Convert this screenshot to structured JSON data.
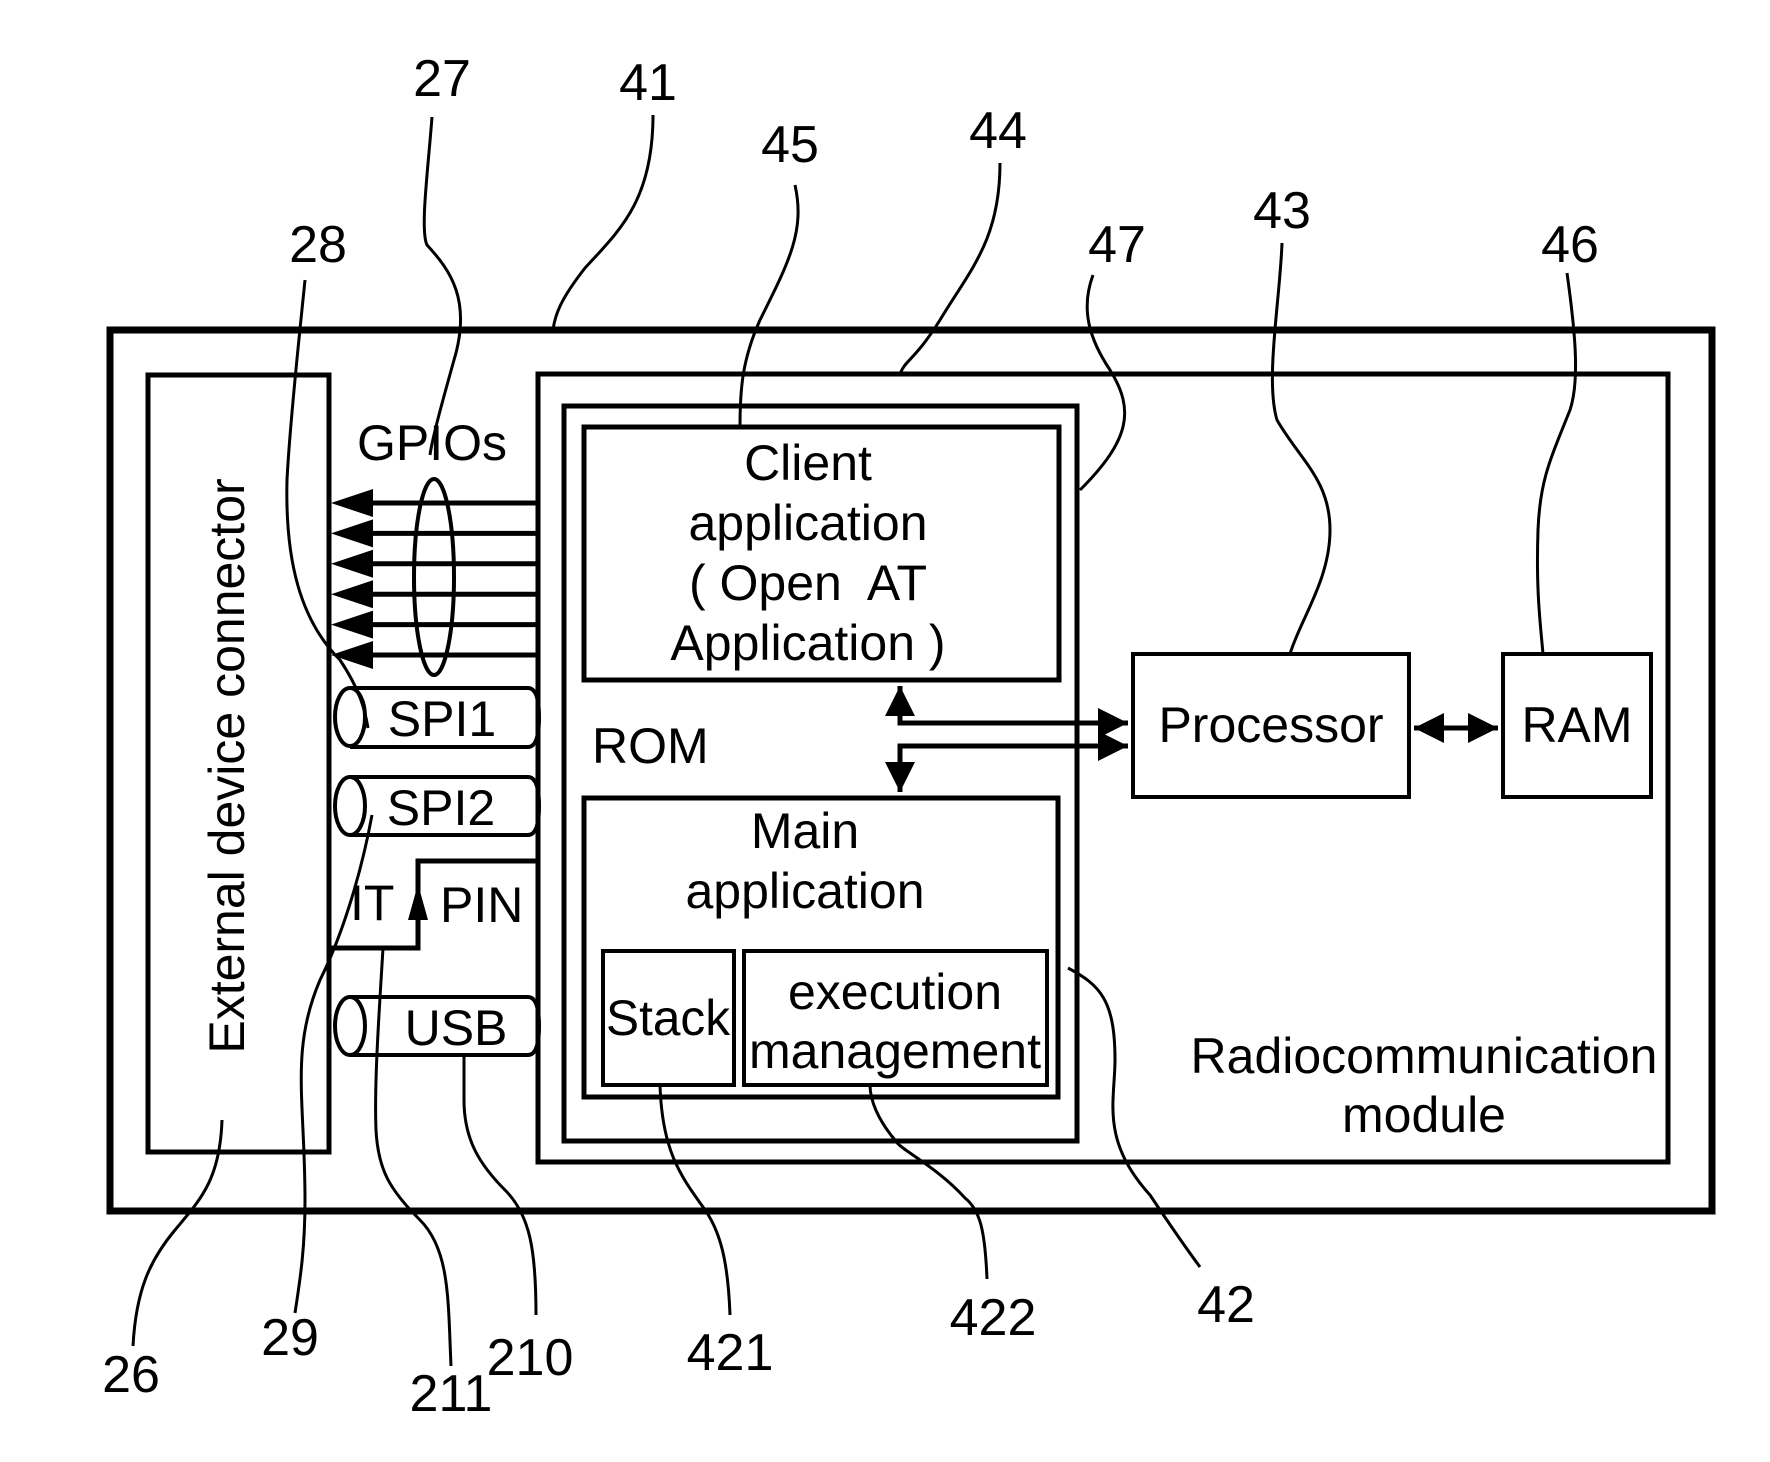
{
  "figure": {
    "type": "block-diagram",
    "colors": {
      "stroke": "#000000",
      "background": "#ffffff"
    }
  },
  "blocks": {
    "outer_device": {
      "ref": "41"
    },
    "connector": {
      "label": "External device connector",
      "ref": "26"
    },
    "module": {
      "label_line1": "Radiocommunication",
      "label_line2": "module",
      "ref": "44"
    },
    "rom": {
      "label": "ROM",
      "ref": "47"
    },
    "client_app": {
      "lines": [
        "Client",
        "application",
        "( Open  AT",
        "Application )"
      ],
      "ref": "45"
    },
    "main_app": {
      "lines": [
        "Main",
        "application"
      ],
      "ref": "42"
    },
    "stack": {
      "label": "Stack",
      "ref": "421"
    },
    "exec_mgmt": {
      "lines": [
        "execution",
        "management"
      ],
      "ref": "422"
    },
    "processor": {
      "label": "Processor",
      "ref": "43"
    },
    "ram": {
      "label": "RAM",
      "ref": "46"
    }
  },
  "interfaces": {
    "gpios": {
      "label": "GPIOs",
      "ref": "27",
      "line_count": 6
    },
    "spi1": {
      "label": "SPI1",
      "ref": "28"
    },
    "spi2": {
      "label": "SPI2",
      "ref": "29"
    },
    "it": {
      "label": "IT"
    },
    "pin": {
      "label": "PIN",
      "ref": "211"
    },
    "usb": {
      "label": "USB",
      "ref": "210"
    }
  }
}
